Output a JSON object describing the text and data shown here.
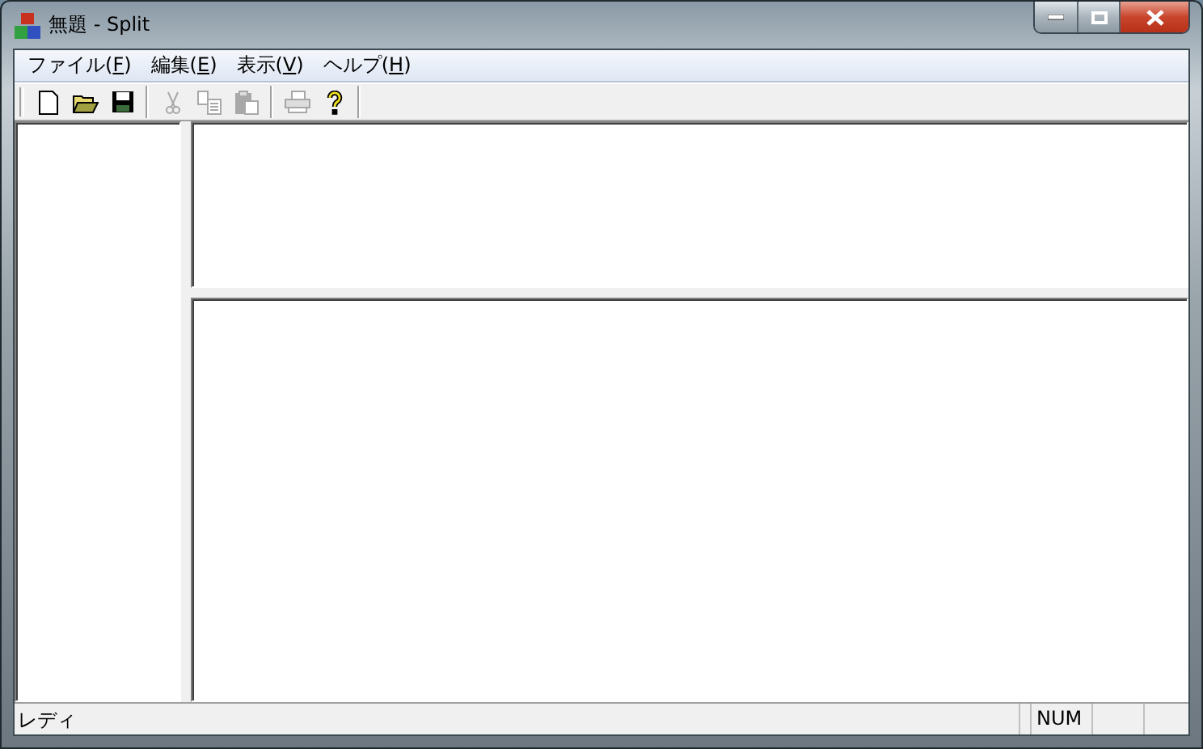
{
  "window": {
    "title": "無題 - Split"
  },
  "menu": [
    {
      "before": "ファイル(",
      "key": "F",
      "after": ")"
    },
    {
      "before": "編集(",
      "key": "E",
      "after": ")"
    },
    {
      "before": "表示(",
      "key": "V",
      "after": ")"
    },
    {
      "before": "ヘルプ(",
      "key": "H",
      "after": ")"
    }
  ],
  "toolbar": [
    {
      "kind": "new",
      "disabled": false
    },
    {
      "kind": "open",
      "disabled": false
    },
    {
      "kind": "save",
      "disabled": false
    },
    {
      "kind": "separator"
    },
    {
      "kind": "cut",
      "disabled": true
    },
    {
      "kind": "copy",
      "disabled": true
    },
    {
      "kind": "paste",
      "disabled": true
    },
    {
      "kind": "separator"
    },
    {
      "kind": "print",
      "disabled": true
    },
    {
      "kind": "help",
      "disabled": false
    }
  ],
  "status_bar": {
    "message": "レディ",
    "indicators": [
      "NUM"
    ]
  }
}
